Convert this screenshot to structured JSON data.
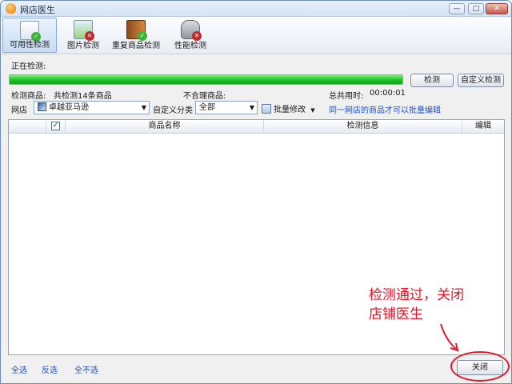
{
  "window": {
    "title": "网店医生",
    "minimize": "—",
    "maximize": "□",
    "close": "✕"
  },
  "toolbar": {
    "tools": [
      {
        "label": "可用性检测",
        "icon": "availability-check-icon"
      },
      {
        "label": "图片检测",
        "icon": "image-check-icon"
      },
      {
        "label": "重复商品检测",
        "icon": "duplicate-check-icon"
      },
      {
        "label": "性能检测",
        "icon": "performance-check-icon"
      }
    ]
  },
  "status": {
    "checking_label": "正在检测:",
    "progress_fraction": 1.0,
    "detect_products_label": "检测商品:",
    "detect_products_value": "共检测14条商品",
    "unreasonable_label": "不合理商品:",
    "total_time_label": "总共用时:",
    "total_time_value": "00:00:01"
  },
  "buttons": {
    "detect": "检测",
    "custom_detect": "自定义检测",
    "close": "关闭"
  },
  "filters": {
    "shop_label": "网店",
    "shop_value": "卓越亚马逊",
    "category_label": "自定义分类",
    "category_value": "全部",
    "bulk_edit": "批量修改",
    "bulk_hint": "同一网店的商品才可以批量编辑"
  },
  "grid": {
    "columns": [
      "",
      "✓",
      "商品名称",
      "检测信息",
      "编辑"
    ],
    "rows": []
  },
  "footer": {
    "select_all": "全选",
    "invert": "反选",
    "select_none": "全不选"
  },
  "annotation": {
    "line1": "检测通过，关闭",
    "line2": "店铺医生",
    "color": "#e3162a"
  }
}
